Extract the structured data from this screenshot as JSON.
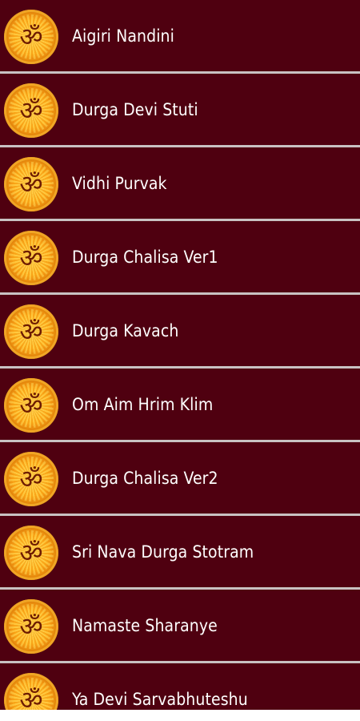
{
  "list": {
    "items": [
      {
        "label": "Aigiri Nandini",
        "icon": "om-icon",
        "icon_glyph": "ॐ"
      },
      {
        "label": "Durga Devi Stuti",
        "icon": "om-icon",
        "icon_glyph": "ॐ"
      },
      {
        "label": "Vidhi Purvak",
        "icon": "om-icon",
        "icon_glyph": "ॐ"
      },
      {
        "label": "Durga Chalisa Ver1",
        "icon": "om-icon",
        "icon_glyph": "ॐ"
      },
      {
        "label": "Durga Kavach",
        "icon": "om-icon",
        "icon_glyph": "ॐ"
      },
      {
        "label": "Om Aim Hrim Klim",
        "icon": "om-icon",
        "icon_glyph": "ॐ"
      },
      {
        "label": "Durga Chalisa Ver2",
        "icon": "om-icon",
        "icon_glyph": "ॐ"
      },
      {
        "label": "Sri Nava Durga Stotram",
        "icon": "om-icon",
        "icon_glyph": "ॐ"
      },
      {
        "label": "Namaste Sharanye",
        "icon": "om-icon",
        "icon_glyph": "ॐ"
      },
      {
        "label": "Ya Devi Sarvabhuteshu",
        "icon": "om-icon",
        "icon_glyph": "ॐ"
      }
    ]
  },
  "colors": {
    "background": "#4f0010",
    "divider": "#c9c2c2",
    "text": "#ffffff",
    "icon_orange": "#f5a012"
  }
}
